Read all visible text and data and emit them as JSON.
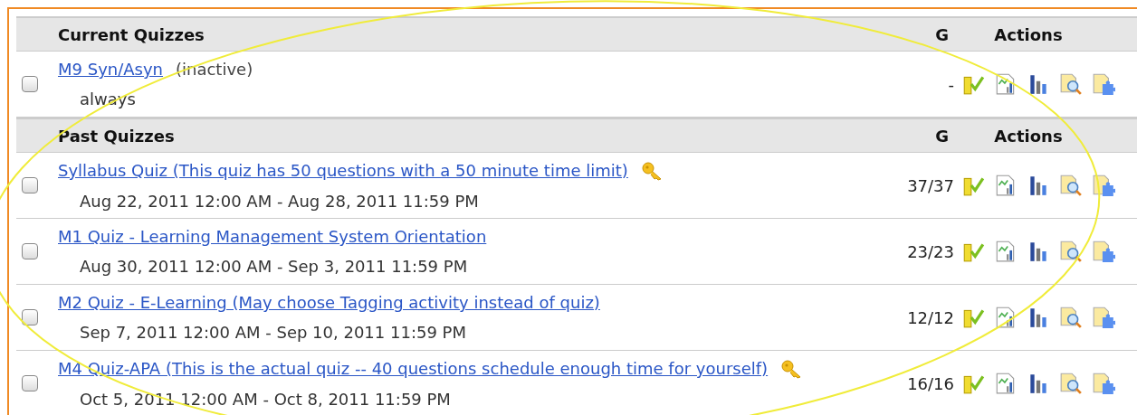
{
  "sections": [
    {
      "title": "Current Quizzes",
      "grade_header": "G",
      "actions_header": "Actions",
      "rows": [
        {
          "title": "M9 Syn/Asyn",
          "status": "(inactive)",
          "dates": "always",
          "grade": "-",
          "has_key": false,
          "checked": false
        }
      ]
    },
    {
      "title": "Past Quizzes",
      "grade_header": "G",
      "actions_header": "Actions",
      "rows": [
        {
          "title": "Syllabus Quiz (This quiz has 50 questions with a 50 minute time limit)",
          "dates": "Aug 22, 2011 12:00 AM - Aug 28, 2011 11:59 PM",
          "grade": "37/37",
          "has_key": true,
          "checked": false
        },
        {
          "title": "M1 Quiz - Learning Management System Orientation",
          "dates": "Aug 30, 2011 12:00 AM - Sep 3, 2011 11:59 PM",
          "grade": "23/23",
          "has_key": false,
          "checked": false
        },
        {
          "title": "M2 Quiz - E-Learning (May choose Tagging activity instead of quiz)",
          "dates": "Sep 7, 2011 12:00 AM - Sep 10, 2011 11:59 PM",
          "grade": "12/12",
          "has_key": false,
          "checked": false
        },
        {
          "title": "M4 Quiz-APA (This is the actual quiz -- 40 questions schedule enough time for yourself)",
          "dates": "Oct 5, 2011 12:00 AM - Oct 8, 2011 11:59 PM",
          "grade": "16/16",
          "has_key": true,
          "checked": false
        }
      ]
    }
  ]
}
